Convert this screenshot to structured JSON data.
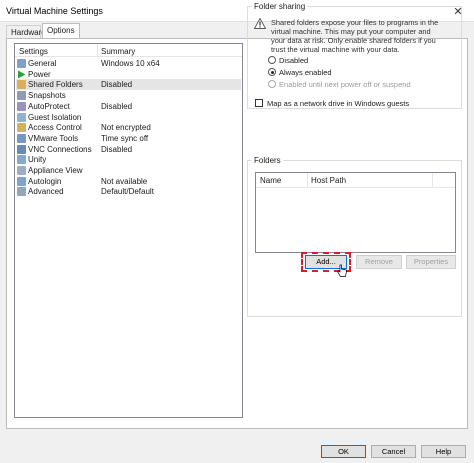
{
  "window": {
    "title": "Virtual Machine Settings",
    "close_glyph": "✕"
  },
  "tabs": [
    {
      "label": "Hardware"
    },
    {
      "label": "Options"
    }
  ],
  "settings": {
    "header_settings": "Settings",
    "header_summary": "Summary",
    "items": [
      {
        "name": "General",
        "summary": "Windows 10 x64",
        "icon": "general-icon",
        "color": "#6a8fbf"
      },
      {
        "name": "Power",
        "summary": "",
        "icon": "power-icon",
        "color": "#2e9e3a"
      },
      {
        "name": "Shared Folders",
        "summary": "Disabled",
        "icon": "shared-folders-icon",
        "color": "#d9a441"
      },
      {
        "name": "Snapshots",
        "summary": "",
        "icon": "snapshots-icon",
        "color": "#7a8ca3"
      },
      {
        "name": "AutoProtect",
        "summary": "Disabled",
        "icon": "autoprotect-icon",
        "color": "#8a7fb5"
      },
      {
        "name": "Guest Isolation",
        "summary": "",
        "icon": "guest-isolation-icon",
        "color": "#7aa5c9"
      },
      {
        "name": "Access Control",
        "summary": "Not encrypted",
        "icon": "access-control-icon",
        "color": "#c9a43a"
      },
      {
        "name": "VMware Tools",
        "summary": "Time sync off",
        "icon": "vmware-tools-icon",
        "color": "#5f87b6"
      },
      {
        "name": "VNC Connections",
        "summary": "Disabled",
        "icon": "vnc-icon",
        "color": "#4f78a8"
      },
      {
        "name": "Unity",
        "summary": "",
        "icon": "unity-icon",
        "color": "#6f9bc6"
      },
      {
        "name": "Appliance View",
        "summary": "",
        "icon": "appliance-view-icon",
        "color": "#8aa0b8"
      },
      {
        "name": "Autologin",
        "summary": "Not available",
        "icon": "autologin-icon",
        "color": "#6b93bf"
      },
      {
        "name": "Advanced",
        "summary": "Default/Default",
        "icon": "advanced-icon",
        "color": "#7f96b0"
      }
    ]
  },
  "folder_sharing": {
    "legend": "Folder sharing",
    "warning_line1": "Shared folders expose your files to programs in the",
    "warning_line2": "virtual machine. This may put your computer and",
    "warning_line3": "your data at risk. Only enable shared folders if you",
    "warning_line4": "trust the virtual machine with your data.",
    "opt_disabled": "Disabled",
    "opt_always": "Always enabled",
    "opt_until": "Enabled until next power off or suspend",
    "map_drive": "Map as a network drive in Windows guests"
  },
  "folders": {
    "legend": "Folders",
    "col_name": "Name",
    "col_host_path": "Host Path",
    "add": "Add...",
    "remove": "Remove",
    "properties": "Properties"
  },
  "footer": {
    "ok": "OK",
    "cancel": "Cancel",
    "help": "Help"
  }
}
